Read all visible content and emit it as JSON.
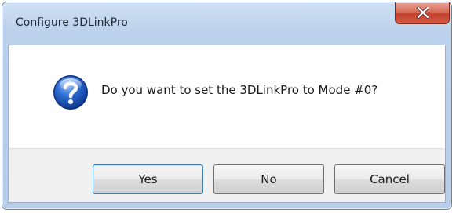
{
  "dialog": {
    "title": "Configure 3DLinkPro",
    "message": "Do you want to set the 3DLinkPro to Mode #0?",
    "icon": "question-icon",
    "close_icon": "close-icon",
    "buttons": {
      "yes": "Yes",
      "no": "No",
      "cancel": "Cancel"
    },
    "default_button": "yes"
  },
  "colors": {
    "titlebar": "#bcd2ec",
    "close_button": "#c2422e",
    "question_icon": "#2b63c7",
    "footer": "#f0f0f0"
  }
}
